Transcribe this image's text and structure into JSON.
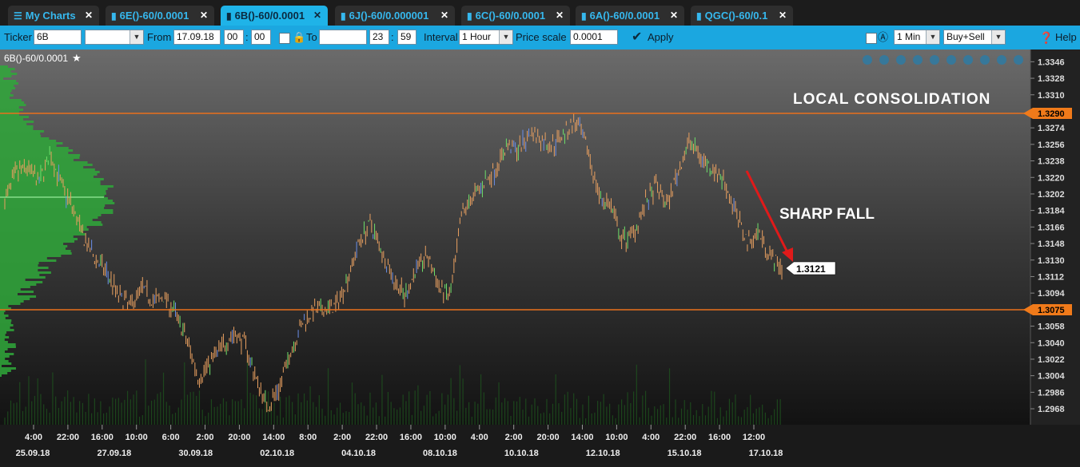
{
  "tabs": [
    {
      "label": "My Charts",
      "icon": "menu-icon"
    },
    {
      "label": "6E()-60/0.0001",
      "icon": "chart-bars-icon"
    },
    {
      "label": "6B()-60/0.0001",
      "icon": "chart-bars-icon",
      "active": true
    },
    {
      "label": "6J()-60/0.000001",
      "icon": "chart-bars-icon"
    },
    {
      "label": "6C()-60/0.0001",
      "icon": "chart-bars-icon"
    },
    {
      "label": "6A()-60/0.0001",
      "icon": "chart-bars-icon"
    },
    {
      "label": "QGC()-60/0.1",
      "icon": "chart-bars-icon"
    }
  ],
  "toolbar": {
    "ticker_label": "Ticker",
    "ticker_value": "6B",
    "from_label": "From",
    "from_date": "17.09.18",
    "from_hour": "00",
    "from_min": "00",
    "to_label": "To",
    "to_date": "",
    "to_hour": "23",
    "to_min": "59",
    "interval_label": "Interval",
    "interval_value": "1 Hour",
    "price_scale_label": "Price scale",
    "price_scale_value": "0.0001",
    "apply_label": "Apply",
    "timeframe_value": "1 Min",
    "mode_value": "Buy+Sell",
    "help_label": "Help"
  },
  "chart": {
    "symbol_label": "6B()-60/0.0001",
    "last_price": "1.3121",
    "annotations": {
      "resistance": "LOCAL CONSOLIDATION",
      "move": "SHARP FALL"
    },
    "levels": [
      {
        "price": "1.3290",
        "color": "#e9711c"
      },
      {
        "price": "1.3075",
        "color": "#e9711c"
      }
    ]
  },
  "chart_data": {
    "type": "bar",
    "title": "6B()-60/0.0001",
    "y_ticks": [
      "1.3346",
      "1.3328",
      "1.3310",
      "1.3274",
      "1.3256",
      "1.3238",
      "1.3220",
      "1.3202",
      "1.3184",
      "1.3166",
      "1.3148",
      "1.3130",
      "1.3112",
      "1.3094",
      "1.3058",
      "1.3040",
      "1.3022",
      "1.3004",
      "1.2986",
      "1.2968"
    ],
    "ylim": [
      1.2955,
      1.3355
    ],
    "x_ticks": [
      "4:00",
      "22:00",
      "16:00",
      "10:00",
      "6:00",
      "2:00",
      "20:00",
      "14:00",
      "8:00",
      "2:00",
      "22:00",
      "16:00",
      "10:00",
      "4:00",
      "2:00",
      "20:00",
      "14:00",
      "10:00",
      "4:00",
      "22:00",
      "16:00",
      "12:00"
    ],
    "date_labels": [
      "25.09.18",
      "27.09.18",
      "30.09.18",
      "02.10.18",
      "04.10.18",
      "08.10.18",
      "10.10.18",
      "12.10.18",
      "15.10.18",
      "17.10.18"
    ],
    "price_path": [
      1.3195,
      1.3225,
      1.323,
      1.3215,
      1.3245,
      1.321,
      1.3185,
      1.315,
      1.313,
      1.3115,
      1.309,
      1.308,
      1.31,
      1.3085,
      1.309,
      1.307,
      1.304,
      1.3,
      1.302,
      1.3035,
      1.305,
      1.304,
      1.3,
      1.297,
      1.299,
      1.303,
      1.306,
      1.3075,
      1.3075,
      1.308,
      1.311,
      1.315,
      1.317,
      1.314,
      1.311,
      1.309,
      1.312,
      1.3135,
      1.31,
      1.309,
      1.318,
      1.32,
      1.3215,
      1.323,
      1.3255,
      1.325,
      1.327,
      1.326,
      1.3255,
      1.327,
      1.328,
      1.325,
      1.32,
      1.319,
      1.315,
      1.316,
      1.319,
      1.321,
      1.319,
      1.323,
      1.326,
      1.324,
      1.323,
      1.3215,
      1.318,
      1.315,
      1.316,
      1.3135,
      1.3121
    ]
  }
}
